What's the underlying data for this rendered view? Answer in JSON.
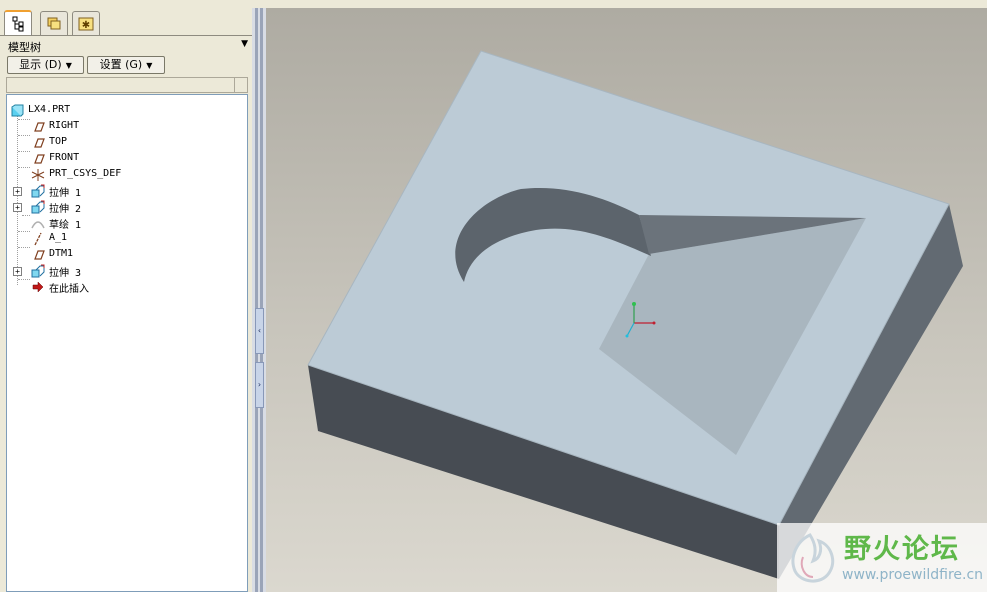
{
  "model_tree": {
    "title": "模型树",
    "show_button": "显示 (D)",
    "settings_button": "设置 (G)",
    "items": [
      {
        "label": "LX4.PRT",
        "icon": "part-icon"
      },
      {
        "label": "RIGHT",
        "icon": "datum-plane-icon"
      },
      {
        "label": "TOP",
        "icon": "datum-plane-icon"
      },
      {
        "label": "FRONT",
        "icon": "datum-plane-icon"
      },
      {
        "label": "PRT_CSYS_DEF",
        "icon": "coordinate-system-icon"
      },
      {
        "label": "拉伸 1",
        "icon": "extrude-icon"
      },
      {
        "label": "拉伸 2",
        "icon": "extrude-icon"
      },
      {
        "label": "草绘 1",
        "icon": "sketch-icon"
      },
      {
        "label": "A_1",
        "icon": "datum-axis-icon"
      },
      {
        "label": "DTM1",
        "icon": "datum-plane-icon"
      },
      {
        "label": "拉伸 3",
        "icon": "extrude-icon"
      },
      {
        "label": "在此插入",
        "icon": "insert-here-arrow-icon"
      }
    ]
  },
  "tabs": [
    "model-tree-tab",
    "layer-tree-tab",
    "favorites-tab"
  ],
  "watermark": {
    "title": "野火论坛",
    "url": "www.proewildfire.cn"
  },
  "colors": {
    "model_top": "#bccbd6",
    "model_side_dark": "#4a4f55",
    "model_side_right": "#6a7178",
    "pocket_floor": "#a9b6bf",
    "accent_tab": "#f0a030"
  }
}
